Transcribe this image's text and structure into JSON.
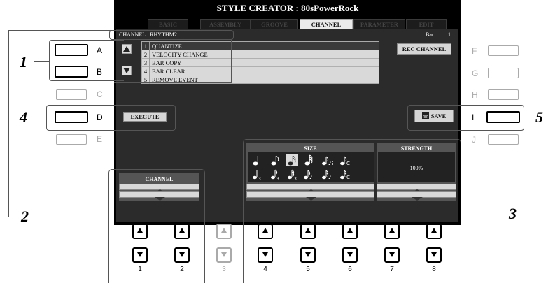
{
  "screen": {
    "title": "STYLE CREATOR : 80sPowerRock",
    "tabs": [
      "BASIC",
      "ASSEMBLY",
      "GROOVE",
      "CHANNEL",
      "PARAMETER",
      "EDIT"
    ],
    "active_tab": "CHANNEL",
    "channel_label": "CHANNEL : RHYTHM2",
    "bar_label": "Bar :",
    "bar_value": "1",
    "menu_items": [
      {
        "num": "1",
        "label": "QUANTIZE"
      },
      {
        "num": "2",
        "label": "VELOCITY CHANGE"
      },
      {
        "num": "3",
        "label": "BAR COPY"
      },
      {
        "num": "4",
        "label": "BAR CLEAR"
      },
      {
        "num": "5",
        "label": "REMOVE EVENT"
      }
    ],
    "execute_label": "EXECUTE",
    "rec_channel_label": "REC CHANNEL",
    "save_label": "SAVE",
    "channel_header": "CHANNEL",
    "size_header": "SIZE",
    "strength_header": "STRENGTH",
    "strength_value": "100%"
  },
  "left_buttons": [
    "A",
    "B",
    "C",
    "D",
    "E"
  ],
  "right_buttons": [
    "F",
    "G",
    "H",
    "I",
    "J"
  ],
  "bottom_numbers": [
    "1",
    "2",
    "3",
    "4",
    "5",
    "6",
    "7",
    "8"
  ],
  "callouts": [
    "1",
    "2",
    "3",
    "4",
    "5"
  ],
  "icons": {
    "up": "up-arrow-icon",
    "down": "down-arrow-icon",
    "save": "floppy-disk-icon",
    "notes": [
      "quarter-note-icon",
      "eighth-note-icon",
      "sixteenth-note-icon",
      "thirty-second-note-icon",
      "sixteenth-plus-eighth-triplet-icon",
      "sixteenth-swing-icon",
      "quarter-triplet-icon",
      "eighth-triplet-icon",
      "sixteenth-triplet-icon",
      "eighth-plus-sixteenth-icon",
      "sixteenth-plus-eighth-icon",
      "eighth-swing-icon"
    ]
  }
}
